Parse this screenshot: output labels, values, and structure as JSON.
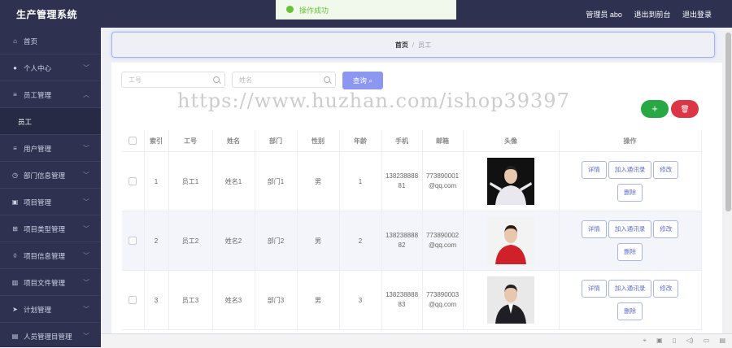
{
  "app": {
    "title": "生产管理系统"
  },
  "toast": {
    "message": "操作成功"
  },
  "header": {
    "user": "管理员 abo",
    "back_label": "退出到前台",
    "logout_label": "退出登录"
  },
  "sidebar": {
    "items": [
      {
        "label": "首页",
        "icon": "home-icon",
        "glyph": "⌂"
      },
      {
        "label": "个人中心",
        "icon": "user-icon",
        "glyph": "●"
      },
      {
        "label": "员工管理",
        "icon": "list-icon",
        "glyph": "≡"
      },
      {
        "label": "用户管理",
        "icon": "list-icon",
        "glyph": "≡"
      },
      {
        "label": "部门信息管理",
        "icon": "clock-icon",
        "glyph": "◷"
      },
      {
        "label": "项目管理",
        "icon": "check-icon",
        "glyph": "▣"
      },
      {
        "label": "项目类型管理",
        "icon": "grid-icon",
        "glyph": "⊞"
      },
      {
        "label": "项目信息管理",
        "icon": "bulb-icon",
        "glyph": "◊"
      },
      {
        "label": "项目文件管理",
        "icon": "bar-chart-icon",
        "glyph": "▥"
      },
      {
        "label": "计划管理",
        "icon": "send-icon",
        "glyph": "➤"
      },
      {
        "label": "人员管理目管理",
        "icon": "doc-icon",
        "glyph": "▤"
      }
    ],
    "sub_item": "员工"
  },
  "breadcrumb": {
    "home": "首页",
    "sep": "/",
    "current": "员工"
  },
  "search": {
    "id_placeholder": "工号",
    "name_placeholder": "姓名",
    "query_label": "查询"
  },
  "buttons": {
    "add": "+",
    "delete": "🗑"
  },
  "watermark": "https://www.huzhan.com/ishop39397",
  "table": {
    "columns": [
      "索引",
      "工号",
      "姓名",
      "部门",
      "性别",
      "年龄",
      "手机",
      "邮箱",
      "头像",
      "操作"
    ],
    "rows": [
      {
        "index": "1",
        "id": "员工1",
        "name": "姓名1",
        "dept": "部门1",
        "gender": "男",
        "age": "1",
        "phone": "13823888881",
        "email": "773890001@qq.com",
        "style": "dark"
      },
      {
        "index": "2",
        "id": "员工2",
        "name": "姓名2",
        "dept": "部门2",
        "gender": "男",
        "age": "2",
        "phone": "13823888882",
        "email": "773890002@qq.com",
        "style": "red"
      },
      {
        "index": "3",
        "id": "员工3",
        "name": "姓名3",
        "dept": "部门3",
        "gender": "男",
        "age": "3",
        "phone": "13823888883",
        "email": "773890003@qq.com",
        "style": "suit"
      }
    ],
    "actions": {
      "detail": "详情",
      "add_contact": "加入通讯录",
      "edit": "修改",
      "delete": "删除"
    }
  }
}
